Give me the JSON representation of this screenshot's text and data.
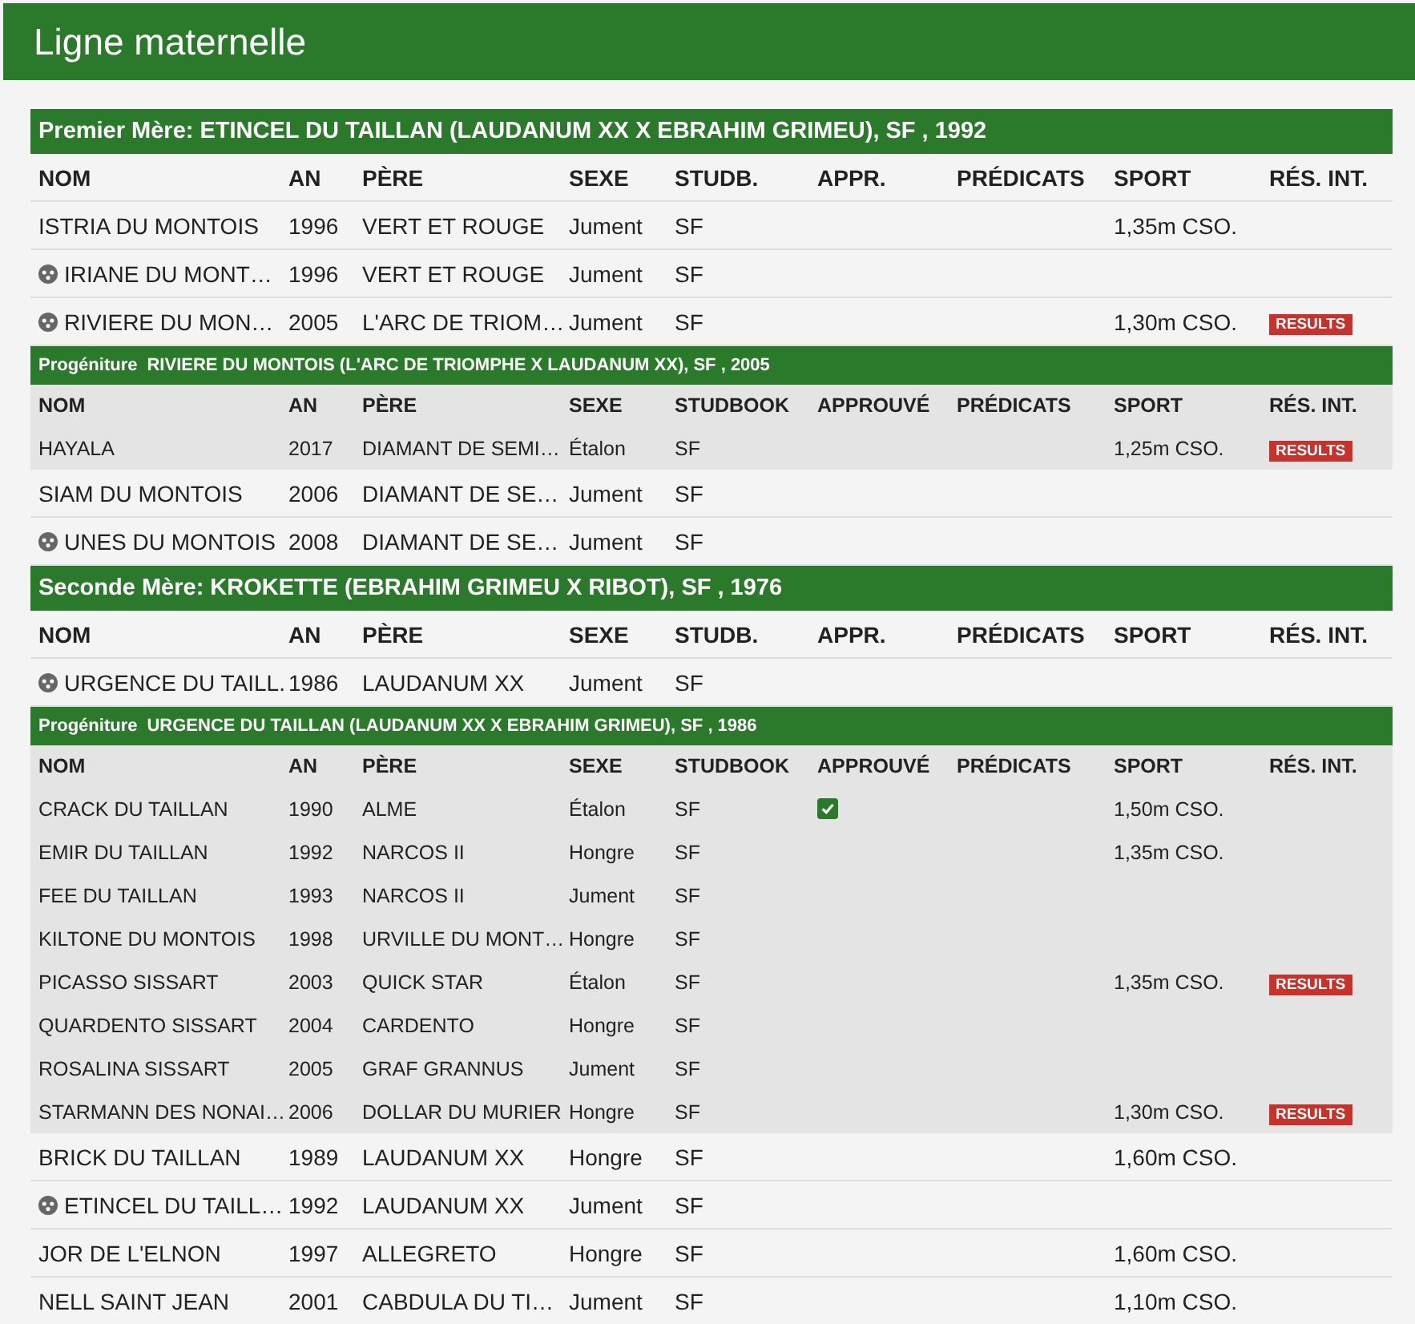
{
  "page_title": "Ligne maternelle",
  "blocks": [
    {
      "kind": "mother",
      "title": "Premier Mère: ETINCEL DU TAILLAN (LAUDANUM XX X EBRAHIM GRIMEU), SF , 1992",
      "columns": [
        "NOM",
        "AN",
        "PÈRE",
        "SEXE",
        "STUDB.",
        "APPR.",
        "PRÉDICATS",
        "SPORT",
        "RÉS. INT."
      ],
      "rows": [
        {
          "name": "ISTRIA DU MONTOIS",
          "icon": false,
          "year": "1996",
          "sire": "VERT ET ROUGE",
          "sex": "Jument",
          "studbook": "SF",
          "sport": "1,35m CSO."
        },
        {
          "name": "IRIANE DU MONT…",
          "icon": true,
          "year": "1996",
          "sire": "VERT ET ROUGE",
          "sex": "Jument",
          "studbook": "SF"
        },
        {
          "name": "RIVIERE DU MON…",
          "icon": true,
          "year": "2005",
          "sire": "L'ARC DE TRIOM…",
          "sex": "Jument",
          "studbook": "SF",
          "sport": "1,30m CSO.",
          "result": "RESULTS"
        }
      ]
    },
    {
      "kind": "progeny",
      "label": "Progéniture",
      "title": "RIVIERE DU MONTOIS (L'ARC DE TRIOMPHE X LAUDANUM XX), SF , 2005",
      "columns": [
        "NOM",
        "AN",
        "PÈRE",
        "SEXE",
        "STUDBOOK",
        "APPROUVÉ",
        "PRÉDICATS",
        "SPORT",
        "RÉS. INT."
      ],
      "rows": [
        {
          "name": "HAYALA",
          "year": "2017",
          "sire": "DIAMANT DE SEMI…",
          "sex": "Étalon",
          "studbook": "SF",
          "approved": false,
          "sport": "1,25m CSO.",
          "result": "RESULTS"
        }
      ]
    },
    {
      "kind": "rows",
      "rows": [
        {
          "name": "SIAM DU MONTOIS",
          "icon": false,
          "year": "2006",
          "sire": "DIAMANT DE SE…",
          "sex": "Jument",
          "studbook": "SF"
        },
        {
          "name": "UNES DU MONTOIS",
          "icon": true,
          "year": "2008",
          "sire": "DIAMANT DE SE…",
          "sex": "Jument",
          "studbook": "SF"
        }
      ]
    },
    {
      "kind": "mother",
      "title": "Seconde Mère: KROKETTE (EBRAHIM GRIMEU X RIBOT), SF , 1976",
      "columns": [
        "NOM",
        "AN",
        "PÈRE",
        "SEXE",
        "STUDB.",
        "APPR.",
        "PRÉDICATS",
        "SPORT",
        "RÉS. INT."
      ],
      "rows": [
        {
          "name": "URGENCE DU TAILL.",
          "icon": true,
          "year": "1986",
          "sire": "LAUDANUM XX",
          "sex": "Jument",
          "studbook": "SF"
        }
      ]
    },
    {
      "kind": "progeny",
      "label": "Progéniture",
      "title": "URGENCE DU TAILLAN (LAUDANUM XX X EBRAHIM GRIMEU), SF , 1986",
      "columns": [
        "NOM",
        "AN",
        "PÈRE",
        "SEXE",
        "STUDBOOK",
        "APPROUVÉ",
        "PRÉDICATS",
        "SPORT",
        "RÉS. INT."
      ],
      "rows": [
        {
          "name": "CRACK DU TAILLAN",
          "year": "1990",
          "sire": "ALME",
          "sex": "Étalon",
          "studbook": "SF",
          "approved": true,
          "sport": "1,50m CSO."
        },
        {
          "name": "EMIR DU TAILLAN",
          "year": "1992",
          "sire": "NARCOS II",
          "sex": "Hongre",
          "studbook": "SF",
          "approved": false,
          "sport": "1,35m CSO."
        },
        {
          "name": "FEE DU TAILLAN",
          "year": "1993",
          "sire": "NARCOS II",
          "sex": "Jument",
          "studbook": "SF",
          "approved": false
        },
        {
          "name": "KILTONE DU MONTOIS",
          "year": "1998",
          "sire": "URVILLE DU MONT…",
          "sex": "Hongre",
          "studbook": "SF",
          "approved": false
        },
        {
          "name": "PICASSO SISSART",
          "year": "2003",
          "sire": "QUICK STAR",
          "sex": "Étalon",
          "studbook": "SF",
          "approved": false,
          "sport": "1,35m CSO.",
          "result": "RESULTS"
        },
        {
          "name": "QUARDENTO SISSART",
          "year": "2004",
          "sire": "CARDENTO",
          "sex": "Hongre",
          "studbook": "SF",
          "approved": false
        },
        {
          "name": "ROSALINA SISSART",
          "year": "2005",
          "sire": "GRAF GRANNUS",
          "sex": "Jument",
          "studbook": "SF",
          "approved": false
        },
        {
          "name": "STARMANN DES NONAI…",
          "year": "2006",
          "sire": "DOLLAR DU MURIER",
          "sex": "Hongre",
          "studbook": "SF",
          "approved": false,
          "sport": "1,30m CSO.",
          "result": "RESULTS"
        }
      ]
    },
    {
      "kind": "rows",
      "rows": [
        {
          "name": "BRICK DU TAILLAN",
          "icon": false,
          "year": "1989",
          "sire": "LAUDANUM XX",
          "sex": "Hongre",
          "studbook": "SF",
          "sport": "1,60m CSO."
        },
        {
          "name": "ETINCEL DU TAILL…",
          "icon": true,
          "year": "1992",
          "sire": "LAUDANUM XX",
          "sex": "Jument",
          "studbook": "SF"
        },
        {
          "name": "JOR DE L'ELNON",
          "icon": false,
          "year": "1997",
          "sire": "ALLEGRETO",
          "sex": "Hongre",
          "studbook": "SF",
          "sport": "1,60m CSO."
        },
        {
          "name": "NELL SAINT JEAN",
          "icon": false,
          "year": "2001",
          "sire": "CABDULA DU TI…",
          "sex": "Jument",
          "studbook": "SF",
          "sport": "1,10m CSO."
        }
      ]
    }
  ]
}
